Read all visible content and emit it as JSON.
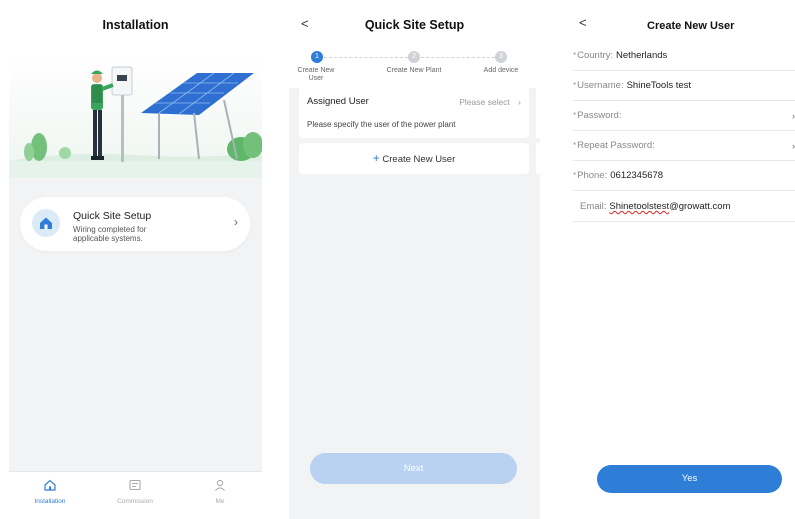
{
  "installation": {
    "title": "Installation",
    "quick_setup": {
      "title": "Quick Site Setup",
      "subtitle": "Wiring completed for applicable systems."
    },
    "tabs": [
      {
        "label": "Installation",
        "icon": "home-icon",
        "active": true
      },
      {
        "label": "Commission",
        "icon": "commission-icon",
        "active": false
      },
      {
        "label": "Me",
        "icon": "user-icon",
        "active": false
      }
    ]
  },
  "quick_site_setup": {
    "title": "Quick Site Setup",
    "steps": [
      {
        "number": "1",
        "label": "Create New User",
        "active": true
      },
      {
        "number": "2",
        "label": "Create New Plant",
        "active": false
      },
      {
        "number": "3",
        "label": "Add device",
        "active": false
      }
    ],
    "assigned_user_label": "Assigned User",
    "assigned_user_select": "Please select",
    "assigned_user_hint": "Please specify the user of the power plant",
    "create_user_button": "Create New User",
    "next_button": "Next"
  },
  "create_new_user": {
    "title": "Create New User",
    "fields": {
      "country": {
        "label": "Country:",
        "value": "Netherlands"
      },
      "username": {
        "label": "Username:",
        "value": "ShineTools test"
      },
      "password": {
        "label": "Password:",
        "value": ""
      },
      "repeat_password": {
        "label": "Repeat Password:",
        "value": ""
      },
      "phone": {
        "label": "Phone:",
        "value": "0612345678"
      },
      "email": {
        "label": "Email:",
        "value_underlined": "Shinetoolstest",
        "value_rest": "@growatt.com"
      }
    },
    "required_marker": "*",
    "yes_button": "Yes"
  },
  "colors": {
    "accent": "#2e7dd6",
    "accent_disabled": "#b9d2f1",
    "background": "#f2f3f5"
  }
}
